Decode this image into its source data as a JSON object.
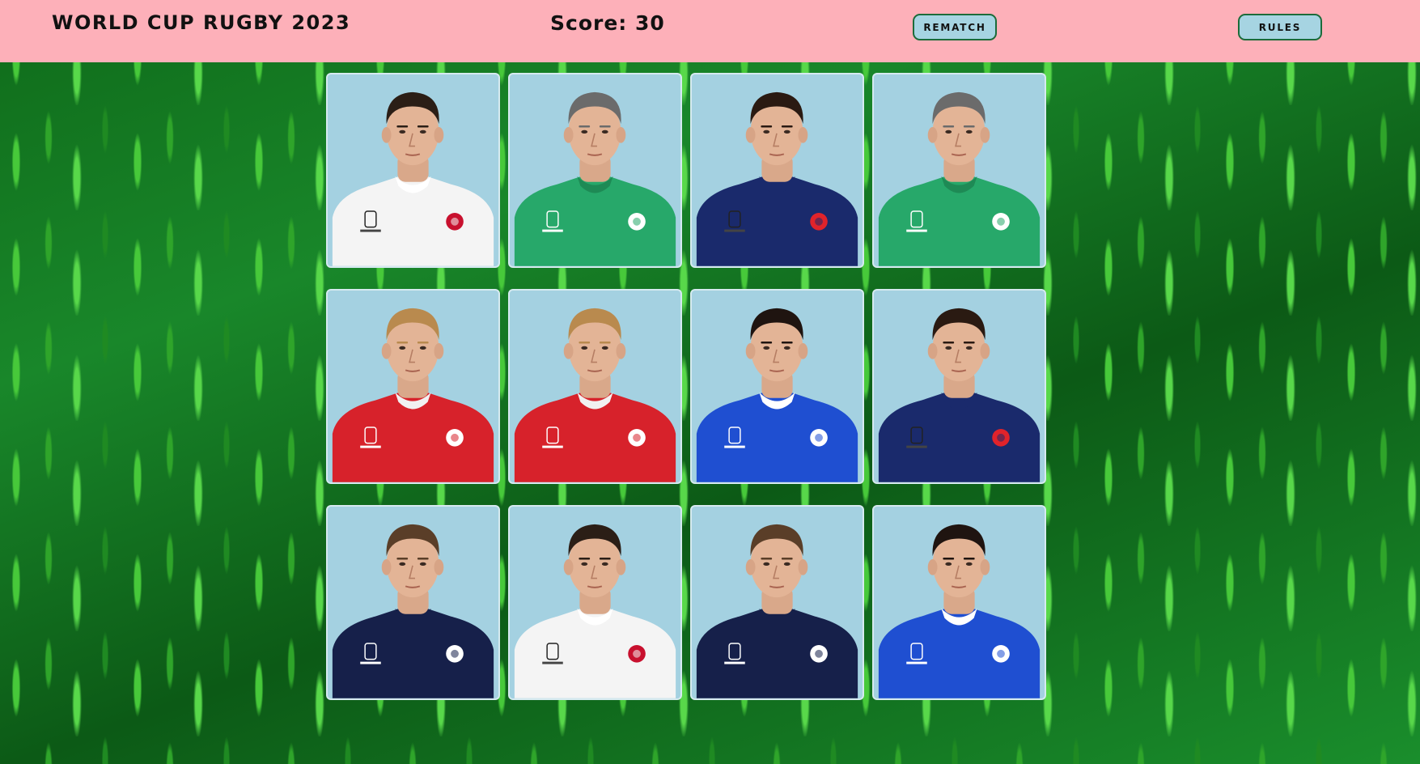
{
  "header": {
    "title": "WORLD CUP RUGBY 2023",
    "score_text": "Score: 30",
    "rematch_label": "REMATCH",
    "rules_label": "RULES"
  },
  "colors": {
    "header_bg": "#fdb0b9",
    "button_bg": "#a6d4e2",
    "button_border": "#1b6b3a",
    "card_bg": "#a4d1e1"
  },
  "cards": [
    {
      "team": "england",
      "jersey": "#f4f4f4",
      "accent": "#c8102e",
      "hair": "#2b1e16",
      "collar": "#ffffff",
      "badge": "rose-icon"
    },
    {
      "team": "ireland",
      "jersey": "#27a86a",
      "accent": "#ffffff",
      "hair": "#6b6b6b",
      "collar": "#1e8a55",
      "badge": "shamrock-icon"
    },
    {
      "team": "france",
      "jersey": "#1a2a6c",
      "accent": "#e0232b",
      "hair": "#2a1a12",
      "collar": "#1a2a6c",
      "badge": "rooster-icon"
    },
    {
      "team": "ireland",
      "jersey": "#27a86a",
      "accent": "#ffffff",
      "hair": "#6b6b6b",
      "collar": "#1e8a55",
      "badge": "shamrock-icon"
    },
    {
      "team": "wales",
      "jersey": "#d7222b",
      "accent": "#ffffff",
      "hair": "#b98a4e",
      "collar": "#f1f1f1",
      "badge": "feathers-icon"
    },
    {
      "team": "wales",
      "jersey": "#d7222b",
      "accent": "#ffffff",
      "hair": "#b98a4e",
      "collar": "#f1f1f1",
      "badge": "feathers-icon"
    },
    {
      "team": "italy",
      "jersey": "#1f4fd1",
      "accent": "#ffffff",
      "hair": "#1f1410",
      "collar": "#ffffff",
      "badge": "italy-shield-icon"
    },
    {
      "team": "france",
      "jersey": "#1a2a6c",
      "accent": "#e0232b",
      "hair": "#2a1a12",
      "collar": "#1a2a6c",
      "badge": "rooster-icon"
    },
    {
      "team": "scotland",
      "jersey": "#16204a",
      "accent": "#ffffff",
      "hair": "#5a3e28",
      "collar": "#16204a",
      "badge": "thistle-icon"
    },
    {
      "team": "england",
      "jersey": "#f4f4f4",
      "accent": "#c8102e",
      "hair": "#2b1e16",
      "collar": "#ffffff",
      "badge": "rose-icon"
    },
    {
      "team": "scotland",
      "jersey": "#16204a",
      "accent": "#ffffff",
      "hair": "#5a3e28",
      "collar": "#16204a",
      "badge": "thistle-icon"
    },
    {
      "team": "italy",
      "jersey": "#1f4fd1",
      "accent": "#ffffff",
      "hair": "#1f1410",
      "collar": "#ffffff",
      "badge": "italy-shield-icon"
    }
  ]
}
